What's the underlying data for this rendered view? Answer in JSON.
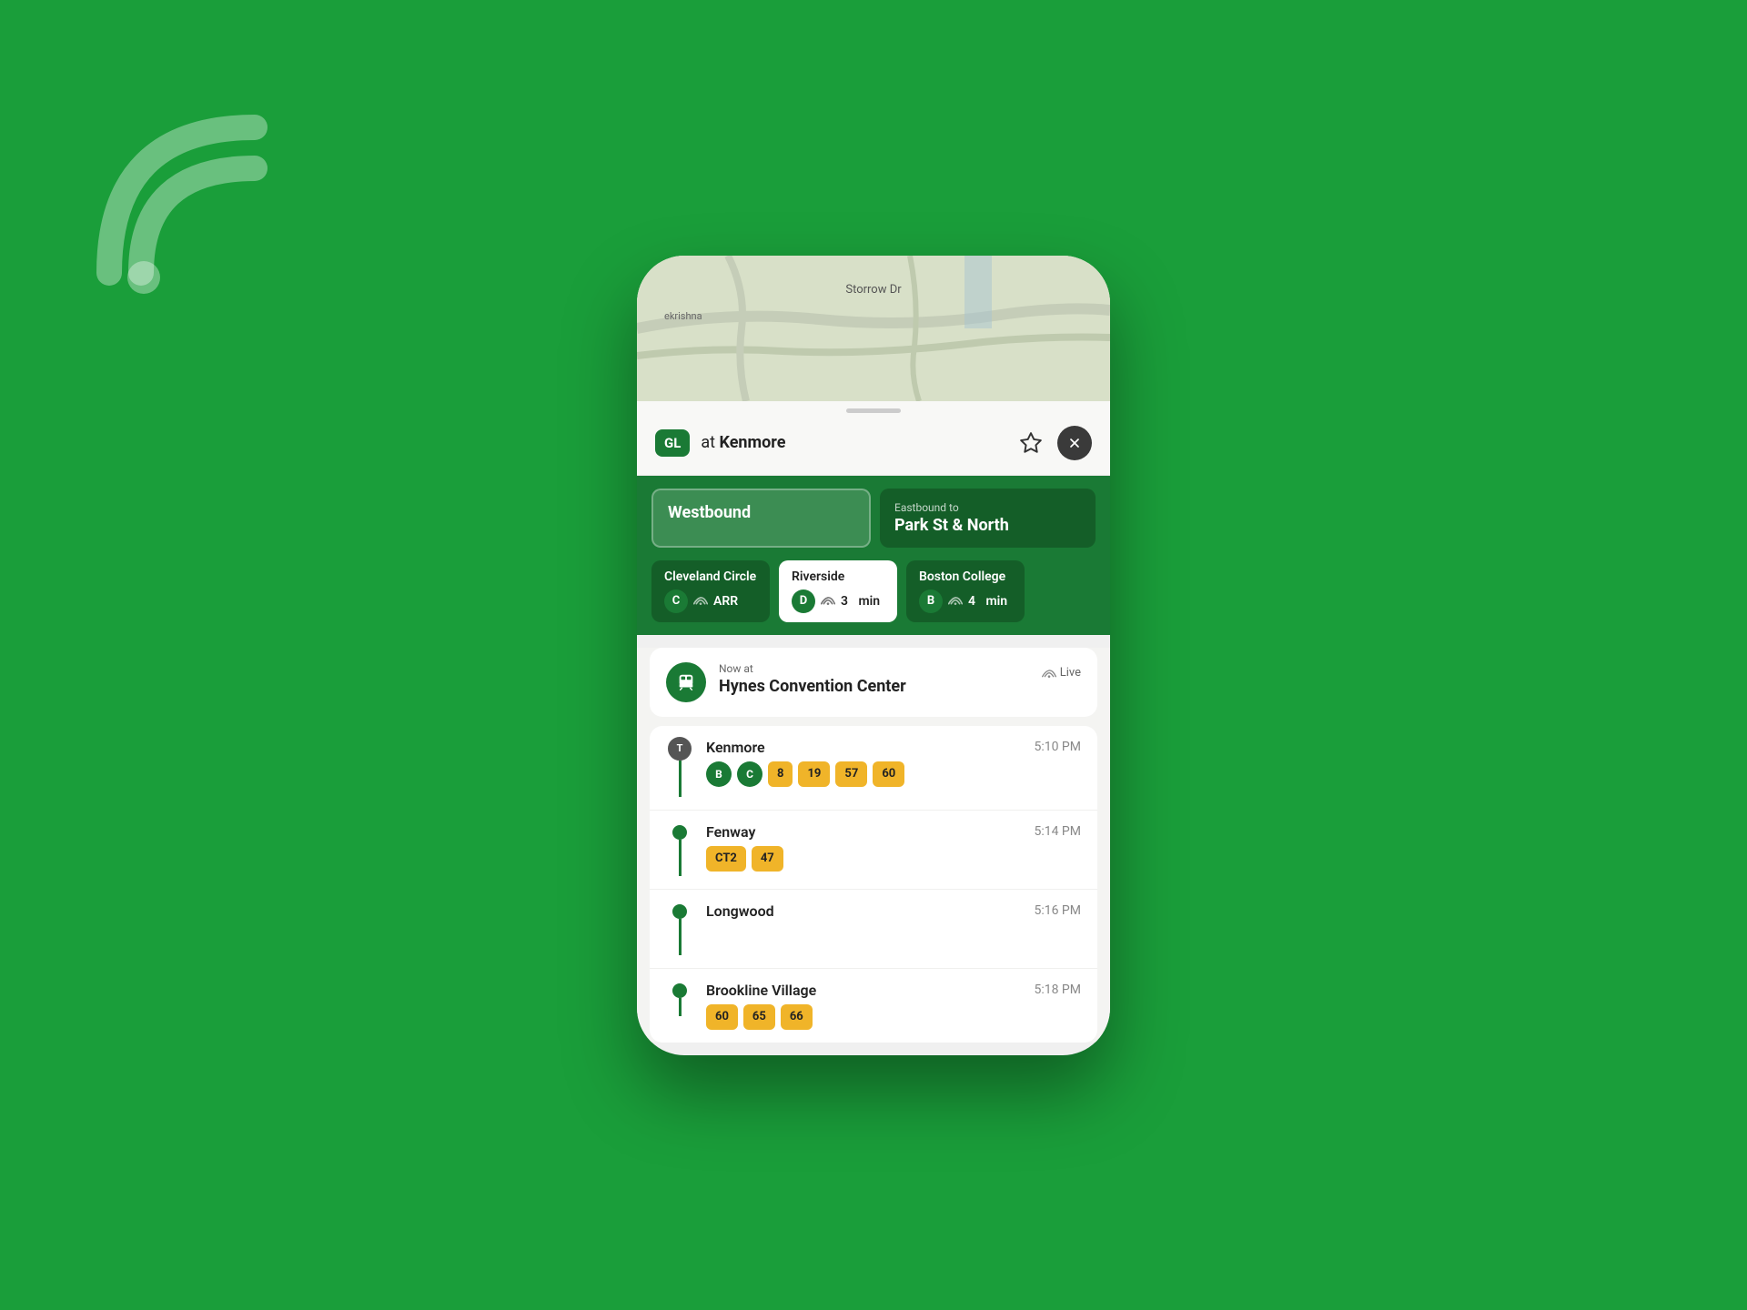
{
  "background_color": "#1a9e3a",
  "wifi_icon": "wifi-signal",
  "map": {
    "road_label": "Storrow Dr",
    "neighborhood_label": "ekrishna"
  },
  "header": {
    "line_badge": "GL",
    "location_prefix": "at",
    "station": "Kenmore",
    "star_label": "favorite",
    "close_label": "close"
  },
  "direction_tabs": [
    {
      "label": "Westbound",
      "active": true
    },
    {
      "sublabel": "Eastbound to",
      "label": "Park St & North",
      "active": false
    }
  ],
  "branch_tabs": [
    {
      "name": "Cleveland Circle",
      "letter": "C",
      "time_label": "ARR",
      "active": false
    },
    {
      "name": "Riverside",
      "letter": "D",
      "time_value": "3",
      "time_unit": "min",
      "active": true
    },
    {
      "name": "Boston College",
      "letter": "B",
      "time_value": "4",
      "time_unit": "min",
      "active": false
    }
  ],
  "now_at": {
    "label": "Now at",
    "station": "Hynes Convention Center",
    "live_label": "Live"
  },
  "stops": [
    {
      "name": "Kenmore",
      "time": "5:10 PM",
      "dot_type": "t",
      "badges_circle": [
        "B",
        "C"
      ],
      "badges_pill": [
        "8",
        "19",
        "57",
        "60"
      ]
    },
    {
      "name": "Fenway",
      "time": "5:14 PM",
      "dot_type": "dot",
      "badges_pill": [
        "CT2",
        "47"
      ]
    },
    {
      "name": "Longwood",
      "time": "5:16 PM",
      "dot_type": "dot",
      "badges_circle": [],
      "badges_pill": []
    },
    {
      "name": "Brookline Village",
      "time": "5:18 PM",
      "dot_type": "dot",
      "badges_pill": [
        "60",
        "65",
        "66"
      ]
    }
  ]
}
